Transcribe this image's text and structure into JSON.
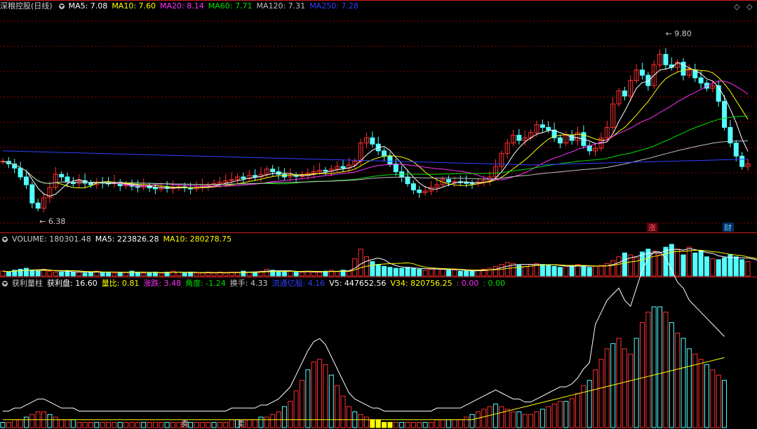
{
  "main_header": {
    "title": "深粮控股(日线)",
    "ma5": "MA5: 7.08",
    "ma10": "MA10: 7.60",
    "ma20": "MA20: 8.14",
    "ma60": "MA60: 7.71",
    "ma120": "MA120: 7.31",
    "ma250": "MA250: 7.28"
  },
  "vol_header": {
    "volume": "VOLUME: 180301.48",
    "ma5": "MA5: 223826.28",
    "ma10": "MA10: 280278.75"
  },
  "ind_header": {
    "name": "获利量柱",
    "profit": "获利盘: 16.60",
    "ratio": "量比: 0.81",
    "change": "涨跌: 3.48",
    "angle": "角度: -1.24",
    "turnover": "换手: 4.33",
    "lowcap": "流通亿股: 4.16",
    "v5": "V5: 447652.56",
    "v34": "V34: 820756.25",
    "z1": ": 0.00",
    "z2": ": 0.00"
  },
  "colors": {
    "up": "#ff3030",
    "down": "#54ffff",
    "ma5": "#ffffff",
    "ma10": "#ffff00",
    "ma20": "#ff30ff",
    "ma60": "#00e000",
    "ma120": "#c0c0c0",
    "ma250": "#3040ff",
    "grid": "#8b0000"
  },
  "controls": {
    "zoom": "◇",
    "close": "◇"
  },
  "chart_data": {
    "type": "candlestick",
    "price_range": [
      6.0,
      10.2
    ],
    "annotations": {
      "high": "9.80",
      "low": "6.38",
      "tag_zhang": "涨",
      "tag_cai": "财",
      "sell1": "卖",
      "sell2": "卖"
    },
    "series": [
      {
        "name": "MA5",
        "value": 7.08
      },
      {
        "name": "MA10",
        "value": 7.6
      },
      {
        "name": "MA20",
        "value": 8.14
      },
      {
        "name": "MA60",
        "value": 7.71
      },
      {
        "name": "MA120",
        "value": 7.31
      },
      {
        "name": "MA250",
        "value": 7.28
      }
    ],
    "close": [
      7.35,
      7.3,
      7.22,
      7.05,
      6.9,
      6.55,
      6.45,
      6.65,
      6.85,
      7.1,
      7.05,
      6.95,
      6.92,
      6.98,
      6.93,
      6.9,
      6.95,
      6.93,
      6.92,
      6.95,
      6.88,
      6.9,
      6.87,
      6.85,
      6.88,
      6.84,
      6.82,
      6.85,
      6.83,
      6.84,
      6.86,
      6.84,
      6.82,
      6.85,
      6.88,
      6.9,
      6.92,
      6.95,
      6.98,
      7.0,
      7.05,
      7.02,
      7.08,
      7.05,
      7.1,
      7.2,
      7.15,
      7.1,
      7.05,
      7.08,
      7.06,
      7.08,
      7.12,
      7.15,
      7.18,
      7.16,
      7.2,
      7.25,
      7.22,
      7.28,
      7.35,
      7.7,
      7.8,
      7.68,
      7.55,
      7.45,
      7.3,
      7.15,
      7.05,
      6.92,
      6.8,
      6.75,
      6.78,
      6.85,
      6.9,
      7.0,
      6.95,
      6.96,
      6.94,
      6.93,
      6.92,
      6.95,
      6.98,
      7.05,
      7.25,
      7.5,
      7.7,
      7.85,
      7.75,
      7.8,
      7.9,
      8.05,
      8.0,
      7.95,
      7.8,
      7.7,
      7.85,
      7.75,
      7.9,
      7.65,
      7.55,
      7.6,
      7.8,
      8.0,
      8.45,
      8.7,
      8.6,
      8.9,
      9.1,
      9.0,
      8.8,
      9.2,
      9.4,
      9.2,
      9.15,
      9.25,
      9.0,
      9.1,
      8.95,
      8.85,
      8.75,
      8.8,
      8.5,
      8.0,
      7.7,
      7.45,
      7.25,
      7.3
    ],
    "volume": [
      5,
      4,
      6,
      7,
      8,
      6,
      5,
      7,
      5,
      4,
      4,
      5,
      4,
      4,
      3,
      4,
      5,
      4,
      4,
      3,
      3,
      4,
      5,
      4,
      3,
      3,
      4,
      3,
      4,
      5,
      4,
      3,
      4,
      3,
      3,
      4,
      3,
      4,
      3,
      4,
      4,
      5,
      4,
      4,
      5,
      7,
      6,
      5,
      4,
      5,
      4,
      4,
      5,
      4,
      4,
      5,
      6,
      5,
      6,
      5,
      18,
      28,
      20,
      15,
      12,
      10,
      9,
      8,
      8,
      9,
      8,
      7,
      6,
      7,
      8,
      7,
      6,
      6,
      5,
      5,
      5,
      6,
      7,
      8,
      10,
      12,
      14,
      13,
      11,
      10,
      12,
      13,
      12,
      11,
      10,
      9,
      10,
      11,
      12,
      10,
      9,
      10,
      11,
      13,
      16,
      20,
      24,
      22,
      19,
      25,
      28,
      26,
      22,
      30,
      33,
      28,
      22,
      30,
      24,
      26,
      20,
      18,
      17,
      19,
      22,
      20,
      17,
      15,
      14,
      12
    ],
    "indicator_bars": [
      2,
      2,
      3,
      3,
      4,
      5,
      6,
      6,
      5,
      4,
      3,
      3,
      3,
      2,
      2,
      2,
      2,
      2,
      2,
      2,
      2,
      2,
      2,
      2,
      2,
      2,
      2,
      2,
      2,
      2,
      2,
      2,
      2,
      2,
      2,
      2,
      2,
      2,
      2,
      3,
      3,
      3,
      3,
      3,
      4,
      4,
      5,
      6,
      8,
      10,
      14,
      18,
      22,
      25,
      26,
      24,
      20,
      16,
      12,
      8,
      6,
      5,
      4,
      3,
      3,
      2,
      2,
      2,
      2,
      2,
      2,
      2,
      2,
      2,
      3,
      3,
      3,
      3,
      3,
      4,
      5,
      6,
      7,
      8,
      9,
      8,
      7,
      6,
      6,
      5,
      5,
      6,
      7,
      8,
      9,
      10,
      10,
      11,
      13,
      16,
      18,
      22,
      26,
      30,
      32,
      34,
      30,
      28,
      34,
      40,
      44,
      46,
      46,
      44,
      40,
      36,
      34,
      30,
      28,
      26,
      24,
      22,
      20,
      18
    ]
  }
}
